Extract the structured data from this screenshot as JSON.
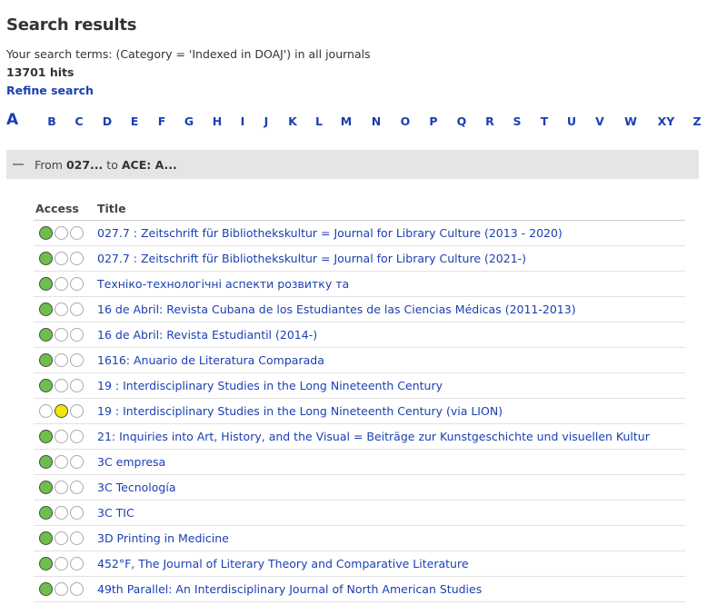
{
  "page": {
    "title": "Search results",
    "search_terms": "Your search terms: (Category = 'Indexed in DOAJ') in all journals",
    "hits": "13701 hits",
    "refine_label": "Refine search"
  },
  "alphabet": {
    "current": "A",
    "letters": [
      "B",
      "C",
      "D",
      "E",
      "F",
      "G",
      "H",
      "I",
      "J",
      "K",
      "L",
      "M",
      "N",
      "O",
      "P",
      "Q",
      "R",
      "S",
      "T",
      "U",
      "V",
      "W",
      "XY",
      "Z"
    ]
  },
  "range": {
    "from_label": "From",
    "from_value": "027...",
    "to_label": "to",
    "to_value": "ACE: A...",
    "toggle_icon": "minus-icon"
  },
  "table": {
    "headers": {
      "access": "Access",
      "title": "Title"
    },
    "colors": {
      "green": "#6cc04a",
      "yellow": "#f2e600",
      "link": "#1a3fb3"
    },
    "rows": [
      {
        "access": "green",
        "title": "027.7 : Zeitschrift für Bibliothekskultur = Journal for Library Culture (2013 - 2020)"
      },
      {
        "access": "green",
        "title": "027.7 : Zeitschrift für Bibliothekskultur = Journal for Library Culture (2021-)"
      },
      {
        "access": "green",
        "title": "Техніко-технологічні аспекти розвитку та"
      },
      {
        "access": "green",
        "title": "16 de Abril: Revista Cubana de los Estudiantes de las Ciencias Médicas (2011-2013)"
      },
      {
        "access": "green",
        "title": "16 de Abril: Revista Estudiantil (2014-)"
      },
      {
        "access": "green",
        "title": "1616: Anuario de Literatura Comparada"
      },
      {
        "access": "green",
        "title": "19 : Interdisciplinary Studies in the Long Nineteenth Century"
      },
      {
        "access": "yellow",
        "title": "19 : Interdisciplinary Studies in the Long Nineteenth Century (via LION)"
      },
      {
        "access": "green",
        "title": "21: Inquiries into Art, History, and the Visual = Beiträge zur Kunstgeschichte und visuellen Kultur"
      },
      {
        "access": "green",
        "title": "3C empresa"
      },
      {
        "access": "green",
        "title": "3C Tecnología"
      },
      {
        "access": "green",
        "title": "3C TIC"
      },
      {
        "access": "green",
        "title": "3D Printing in Medicine"
      },
      {
        "access": "green",
        "title": "452°F, The Journal of Literary Theory and Comparative Literature"
      },
      {
        "access": "green",
        "title": "49th Parallel: An Interdisciplinary Journal of North American Studies"
      }
    ]
  }
}
